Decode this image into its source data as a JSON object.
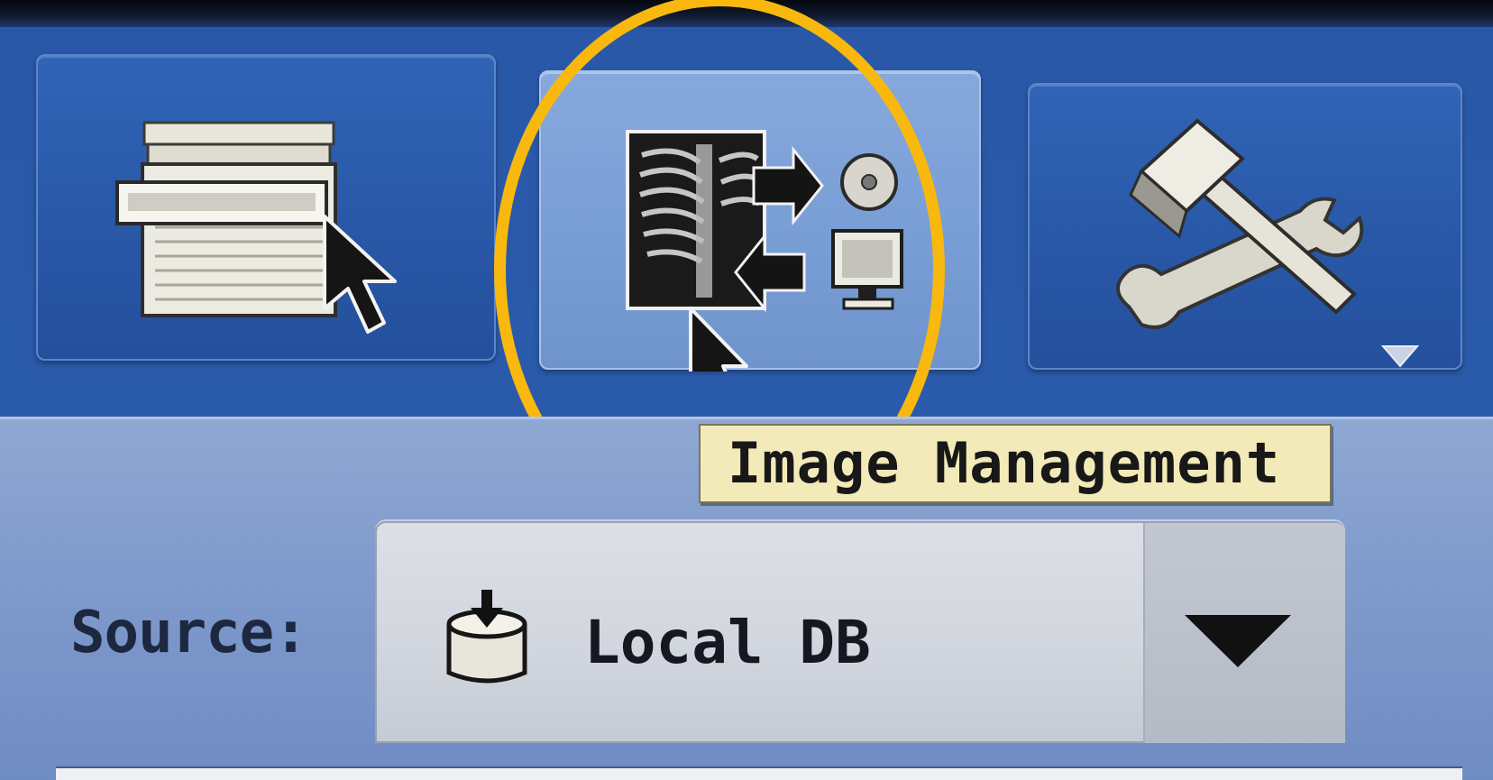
{
  "toolbar": {
    "buttons": [
      {
        "id": "worklist",
        "icon": "worklist-form-icon",
        "state": "normal"
      },
      {
        "id": "image-management",
        "icon": "image-management-icon",
        "state": "hover"
      },
      {
        "id": "tools",
        "icon": "hammer-wrench-icon",
        "state": "normal",
        "has_dropdown": true
      }
    ]
  },
  "tooltip": {
    "text": "Image Management"
  },
  "source": {
    "label": "Source:",
    "selected": "Local DB",
    "selected_icon": "database-icon"
  },
  "colors": {
    "toolbar_blue": "#2a59a9",
    "active_button": "#7a9fd6",
    "highlight_ring": "#f8b80e",
    "tooltip_bg": "#f3eab9",
    "panel": "#7f9acb"
  }
}
